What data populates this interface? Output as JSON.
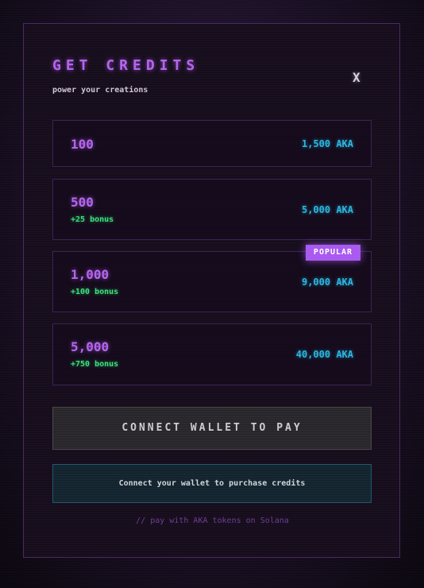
{
  "modal": {
    "title": "GET CREDITS",
    "subtitle": "power your creations",
    "close_label": "X"
  },
  "packages": [
    {
      "credits": "100",
      "bonus": "",
      "price": "1,500 AKA"
    },
    {
      "credits": "500",
      "bonus": "+25 bonus",
      "price": "5,000 AKA"
    },
    {
      "credits": "1,000",
      "bonus": "+100 bonus",
      "price": "9,000 AKA",
      "badge": "POPULAR"
    },
    {
      "credits": "5,000",
      "bonus": "+750 bonus",
      "price": "40,000 AKA"
    }
  ],
  "connect_button_label": "CONNECT WALLET TO PAY",
  "notice": "Connect your wallet to purchase credits",
  "footer_note": "// pay with AKA tokens on Solana",
  "colors": {
    "accent_purple": "#b565f0",
    "bonus_green": "#39e27a",
    "price_cyan": "#2bb7e0",
    "badge_purple": "#a95af0"
  }
}
